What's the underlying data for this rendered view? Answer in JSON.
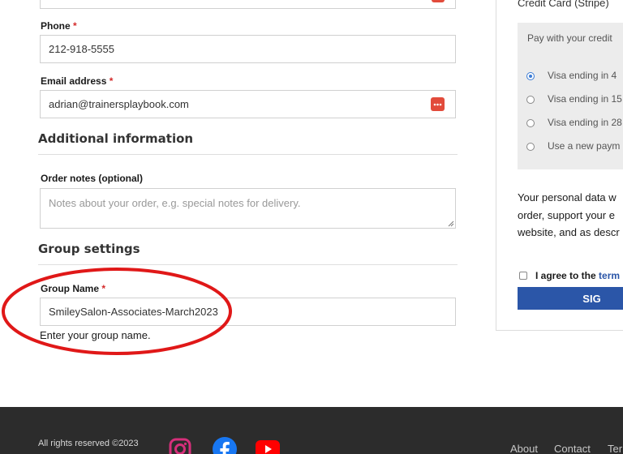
{
  "form": {
    "phone": {
      "label": "Phone",
      "required_mark": "*",
      "value": "212-918-5555"
    },
    "email": {
      "label": "Email address",
      "required_mark": "*",
      "value": "adrian@trainersplaybook.com"
    },
    "additional_heading": "Additional information",
    "order_notes": {
      "label": "Order notes (optional)",
      "placeholder": "Notes about your order, e.g. special notes for delivery."
    },
    "group_heading": "Group settings",
    "group_name": {
      "label": "Group Name",
      "required_mark": "*",
      "value": "SmileySalon-Associates-March2023",
      "help": "Enter your group name."
    }
  },
  "payment": {
    "method_title": "Credit Card (Stripe)",
    "intro": "Pay with your credit",
    "options": [
      {
        "label": "Visa ending in 4",
        "selected": true
      },
      {
        "label": "Visa ending in 15",
        "selected": false
      },
      {
        "label": "Visa ending in 28",
        "selected": false
      },
      {
        "label": "Use a new paym",
        "selected": false
      }
    ],
    "privacy_lines": [
      "Your personal data w",
      "order, support your e",
      "website, and as descr"
    ],
    "terms_prefix": "I agree to the",
    "terms_link": "term",
    "submit_label": "SIG"
  },
  "footer": {
    "copyright": "All rights reserved ©2023",
    "links": [
      "About",
      "Contact",
      "Ter"
    ]
  },
  "colors": {
    "accent_blue": "#2b56a8",
    "annotation_red": "#e01818",
    "required_red": "#d42a2a",
    "footer_bg": "#2c2c2c"
  },
  "icons": [
    "password-manager-icon",
    "instagram-icon",
    "facebook-icon",
    "youtube-icon"
  ]
}
